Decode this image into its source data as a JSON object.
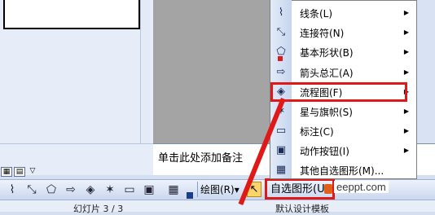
{
  "notes_placeholder": "单击此处添加备注",
  "toolbar": {
    "draw_label": "绘图(R)",
    "draw_arrow": "▾",
    "autoshapes_label": "自选图形(U)",
    "cursor_glyph": "↖",
    "overflow_glyph": "▼"
  },
  "status": {
    "slide": "幻灯片 3 / 3",
    "design": "默认设计模板"
  },
  "menu": {
    "items": [
      {
        "label": "线条(L)",
        "icon": "⌇",
        "arrow": "▶"
      },
      {
        "label": "连接符(N)",
        "icon": "⤡",
        "arrow": "▶"
      },
      {
        "label": "基本形状(B)",
        "icon": "⬠",
        "arrow": "▶"
      },
      {
        "label": "箭头总汇(A)",
        "icon": "⇨",
        "arrow": "▶"
      },
      {
        "label": "流程图(F)",
        "icon": "◈",
        "arrow": "▶"
      },
      {
        "label": "星与旗帜(S)",
        "icon": "✶",
        "arrow": "▶"
      },
      {
        "label": "标注(C)",
        "icon": "▭",
        "arrow": "▶"
      },
      {
        "label": "动作按钮(I)",
        "icon": "▣",
        "arrow": "▶"
      },
      {
        "label": "其他自选图形(M)...",
        "icon": "▦",
        "arrow": ""
      }
    ]
  },
  "view_buttons": [
    "▦",
    "▤",
    "▽"
  ],
  "toolbar_icons": [
    "⌇",
    "⤡",
    "⬠",
    "⇨",
    "◈",
    "✶",
    "▭",
    "▣",
    "▦",
    "✎"
  ],
  "watermark": "eeppt.com",
  "colors": {
    "highlight": "#e01818",
    "toolbar": "#c9d6ee",
    "canvas": "#a4a4a4"
  }
}
